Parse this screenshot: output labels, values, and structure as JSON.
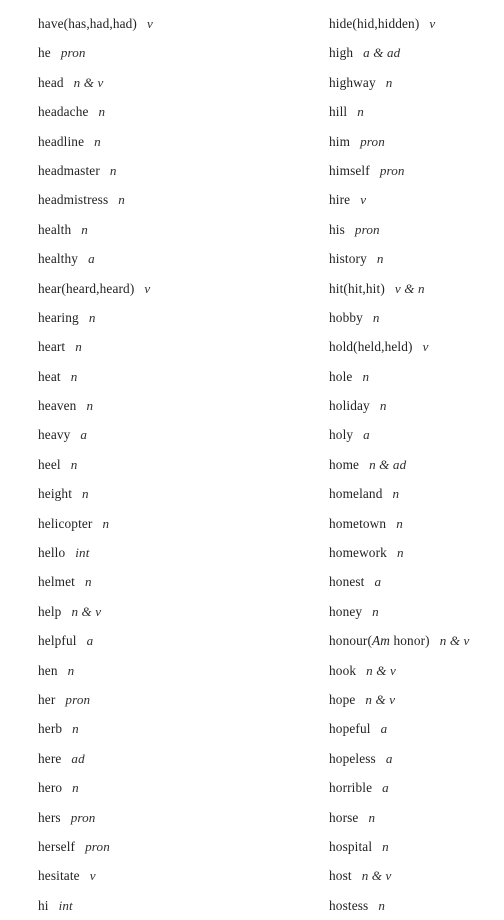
{
  "page": {
    "type": "scanned-vocabulary-list",
    "background_color": "#ffffff",
    "text_color": "#262626",
    "columns": 2
  },
  "left_column": {
    "entries": [
      {
        "word": "have(has,had,had)",
        "pos": "v"
      },
      {
        "word": "he",
        "pos": "pron"
      },
      {
        "word": "head",
        "pos": "n & v"
      },
      {
        "word": "headache",
        "pos": "n"
      },
      {
        "word": "headline",
        "pos": "n"
      },
      {
        "word": "headmaster",
        "pos": "n"
      },
      {
        "word": "headmistress",
        "pos": "n"
      },
      {
        "word": "health",
        "pos": "n"
      },
      {
        "word": "healthy",
        "pos": "a"
      },
      {
        "word": "hear(heard,heard)",
        "pos": "v"
      },
      {
        "word": "hearing",
        "pos": "n"
      },
      {
        "word": "heart",
        "pos": "n"
      },
      {
        "word": "heat",
        "pos": "n"
      },
      {
        "word": "heaven",
        "pos": "n"
      },
      {
        "word": "heavy",
        "pos": "a"
      },
      {
        "word": "heel",
        "pos": "n"
      },
      {
        "word": "height",
        "pos": "n"
      },
      {
        "word": "helicopter",
        "pos": "n"
      },
      {
        "word": "hello",
        "pos": "int"
      },
      {
        "word": "helmet",
        "pos": "n"
      },
      {
        "word": "help",
        "pos": "n & v"
      },
      {
        "word": "helpful",
        "pos": "a"
      },
      {
        "word": "hen",
        "pos": "n"
      },
      {
        "word": "her",
        "pos": "pron"
      },
      {
        "word": "herb",
        "pos": "n"
      },
      {
        "word": "here",
        "pos": "ad"
      },
      {
        "word": "hero",
        "pos": "n"
      },
      {
        "word": "hers",
        "pos": "pron"
      },
      {
        "word": "herself",
        "pos": "pron"
      },
      {
        "word": "hesitate",
        "pos": "v"
      },
      {
        "word": "hi",
        "pos": "int"
      }
    ]
  },
  "right_column": {
    "entries": [
      {
        "word": "hide(hid,hidden)",
        "pos": "v"
      },
      {
        "word": "high",
        "pos": "a & ad"
      },
      {
        "word": "highway",
        "pos": "n"
      },
      {
        "word": "hill",
        "pos": "n"
      },
      {
        "word": "him",
        "pos": "pron"
      },
      {
        "word": "himself",
        "pos": "pron"
      },
      {
        "word": "hire",
        "pos": "v"
      },
      {
        "word": "his",
        "pos": "pron"
      },
      {
        "word": "history",
        "pos": "n"
      },
      {
        "word": "hit(hit,hit)",
        "pos": "v & n"
      },
      {
        "word": "hobby",
        "pos": "n"
      },
      {
        "word": "hold(held,held)",
        "pos": "v"
      },
      {
        "word": "hole",
        "pos": "n"
      },
      {
        "word": "holiday",
        "pos": "n"
      },
      {
        "word": "holy",
        "pos": "a"
      },
      {
        "word": "home",
        "pos": "n & ad"
      },
      {
        "word": "homeland",
        "pos": "n"
      },
      {
        "word": "hometown",
        "pos": "n"
      },
      {
        "word": "homework",
        "pos": "n"
      },
      {
        "word": "honest",
        "pos": "a"
      },
      {
        "word": "honey",
        "pos": "n"
      },
      {
        "word": "honour(Am honor)",
        "pos": "n & v",
        "word_parts": [
          {
            "text": "honour(",
            "italic": false
          },
          {
            "text": "Am",
            "italic": true
          },
          {
            "text": " honor)",
            "italic": false
          }
        ]
      },
      {
        "word": "hook",
        "pos": "n & v"
      },
      {
        "word": "hope",
        "pos": "n & v"
      },
      {
        "word": "hopeful",
        "pos": "a"
      },
      {
        "word": "hopeless",
        "pos": "a"
      },
      {
        "word": "horrible",
        "pos": "a"
      },
      {
        "word": "horse",
        "pos": "n"
      },
      {
        "word": "hospital",
        "pos": "n"
      },
      {
        "word": "host",
        "pos": "n & v"
      },
      {
        "word": "hostess",
        "pos": "n"
      }
    ]
  }
}
